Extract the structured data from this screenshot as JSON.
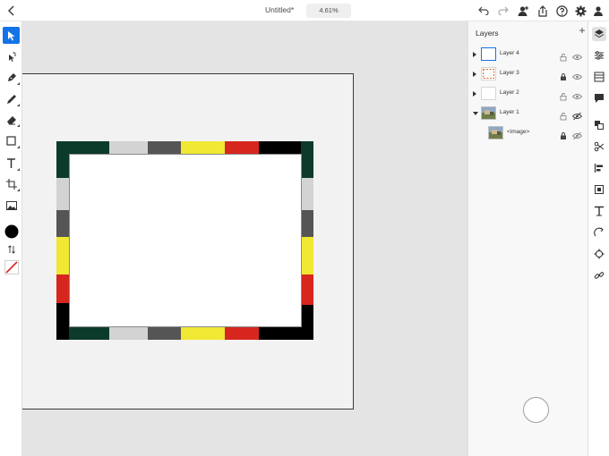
{
  "header": {
    "document_title": "Untitled*",
    "zoom_level": "4.61%"
  },
  "layers_panel": {
    "title": "Layers",
    "layers": [
      {
        "name": "Layer 4",
        "expanded": false,
        "locked": false,
        "visible": true,
        "thumb": "blue-outline"
      },
      {
        "name": "Layer 3",
        "expanded": false,
        "locked": true,
        "visible": true,
        "thumb": "dashed-frame"
      },
      {
        "name": "Layer 2",
        "expanded": false,
        "locked": false,
        "visible": true,
        "thumb": "blank"
      },
      {
        "name": "Layer 1",
        "expanded": true,
        "locked": false,
        "visible": false,
        "thumb": "image"
      }
    ],
    "sublayers": [
      {
        "name": "<image>",
        "locked": true,
        "visible": false
      }
    ]
  },
  "colors": {
    "accent": "#1473e6",
    "fill_color": "#000000",
    "stroke_color": "#d7261e",
    "frame": {
      "green": "#0c3a2b",
      "light_gray": "#d3d3d3",
      "dark_gray": "#555555",
      "yellow": "#f0e833",
      "red": "#d7261e",
      "black": "#000000"
    }
  }
}
